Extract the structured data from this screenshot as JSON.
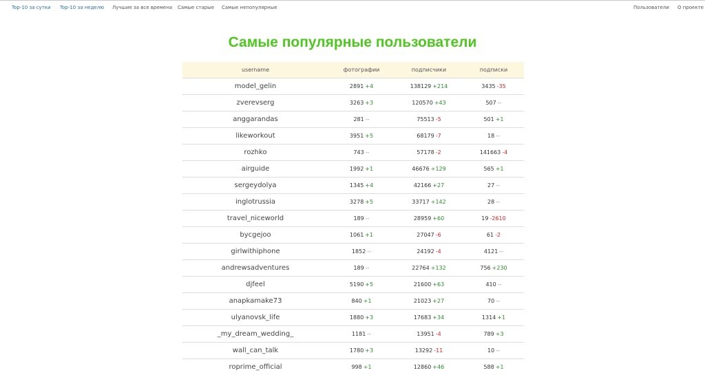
{
  "nav": {
    "left": [
      {
        "label": "Top-10 за сутки"
      },
      {
        "label": "Top-10 за неделю"
      },
      {
        "label": "Лучшие за все времена"
      },
      {
        "label": "Самые старые"
      },
      {
        "label": "Самые непопулярные"
      }
    ],
    "right": [
      {
        "label": "Пользователи"
      },
      {
        "label": "О проекте"
      }
    ]
  },
  "page": {
    "title": "Самые популярные пользователи"
  },
  "colors": {
    "title": "#4ec71f",
    "header_bg": "#fdf7df",
    "delta_up": "#2e8b2e",
    "delta_down": "#d9262a",
    "delta_none": "#888888"
  },
  "table": {
    "headers": {
      "username": "username",
      "photos": "фотографии",
      "followers": "подписчики",
      "following": "подписки"
    },
    "rows": [
      {
        "username": "model_gelin",
        "photos": "2891",
        "photos_delta": "+4",
        "followers": "138129",
        "followers_delta": "+214",
        "following": "3435",
        "following_delta": "-35"
      },
      {
        "username": "zverevserg",
        "photos": "3263",
        "photos_delta": "+3",
        "followers": "120570",
        "followers_delta": "+43",
        "following": "507",
        "following_delta": "--"
      },
      {
        "username": "anggarandas",
        "photos": "281",
        "photos_delta": "--",
        "followers": "75513",
        "followers_delta": "-5",
        "following": "501",
        "following_delta": "+1"
      },
      {
        "username": "likeworkout",
        "photos": "3951",
        "photos_delta": "+5",
        "followers": "68179",
        "followers_delta": "-7",
        "following": "18",
        "following_delta": "--"
      },
      {
        "username": "rozhko",
        "photos": "743",
        "photos_delta": "--",
        "followers": "57178",
        "followers_delta": "-2",
        "following": "141663",
        "following_delta": "-4"
      },
      {
        "username": "airguide",
        "photos": "1992",
        "photos_delta": "+1",
        "followers": "46676",
        "followers_delta": "+129",
        "following": "565",
        "following_delta": "+1"
      },
      {
        "username": "sergeydolya",
        "photos": "1345",
        "photos_delta": "+4",
        "followers": "42166",
        "followers_delta": "+27",
        "following": "27",
        "following_delta": "--"
      },
      {
        "username": "inglotrussia",
        "photos": "3278",
        "photos_delta": "+5",
        "followers": "33717",
        "followers_delta": "+142",
        "following": "28",
        "following_delta": "--"
      },
      {
        "username": "travel_niceworld",
        "photos": "189",
        "photos_delta": "--",
        "followers": "28959",
        "followers_delta": "+60",
        "following": "19",
        "following_delta": "-2610"
      },
      {
        "username": "bycgejoo",
        "photos": "1061",
        "photos_delta": "+1",
        "followers": "27047",
        "followers_delta": "-6",
        "following": "61",
        "following_delta": "-2"
      },
      {
        "username": "girlwithiphone",
        "photos": "1852",
        "photos_delta": "--",
        "followers": "24192",
        "followers_delta": "-4",
        "following": "4121",
        "following_delta": "--"
      },
      {
        "username": "andrewsadventures",
        "photos": "189",
        "photos_delta": "--",
        "followers": "22764",
        "followers_delta": "+132",
        "following": "756",
        "following_delta": "+230"
      },
      {
        "username": "djfeel",
        "photos": "5190",
        "photos_delta": "+5",
        "followers": "21600",
        "followers_delta": "+63",
        "following": "410",
        "following_delta": "--"
      },
      {
        "username": "anapkamake73",
        "photos": "840",
        "photos_delta": "+1",
        "followers": "21023",
        "followers_delta": "+27",
        "following": "70",
        "following_delta": "--"
      },
      {
        "username": "ulyanovsk_life",
        "photos": "1880",
        "photos_delta": "+3",
        "followers": "17683",
        "followers_delta": "+34",
        "following": "1314",
        "following_delta": "+1"
      },
      {
        "username": "_my_dream_wedding_",
        "photos": "1181",
        "photos_delta": "--",
        "followers": "13951",
        "followers_delta": "-4",
        "following": "789",
        "following_delta": "+3"
      },
      {
        "username": "wall_can_talk",
        "photos": "1780",
        "photos_delta": "+3",
        "followers": "13292",
        "followers_delta": "-11",
        "following": "10",
        "following_delta": "--"
      },
      {
        "username": "roprime_official",
        "photos": "998",
        "photos_delta": "+1",
        "followers": "12860",
        "followers_delta": "+46",
        "following": "588",
        "following_delta": "+1"
      }
    ]
  }
}
